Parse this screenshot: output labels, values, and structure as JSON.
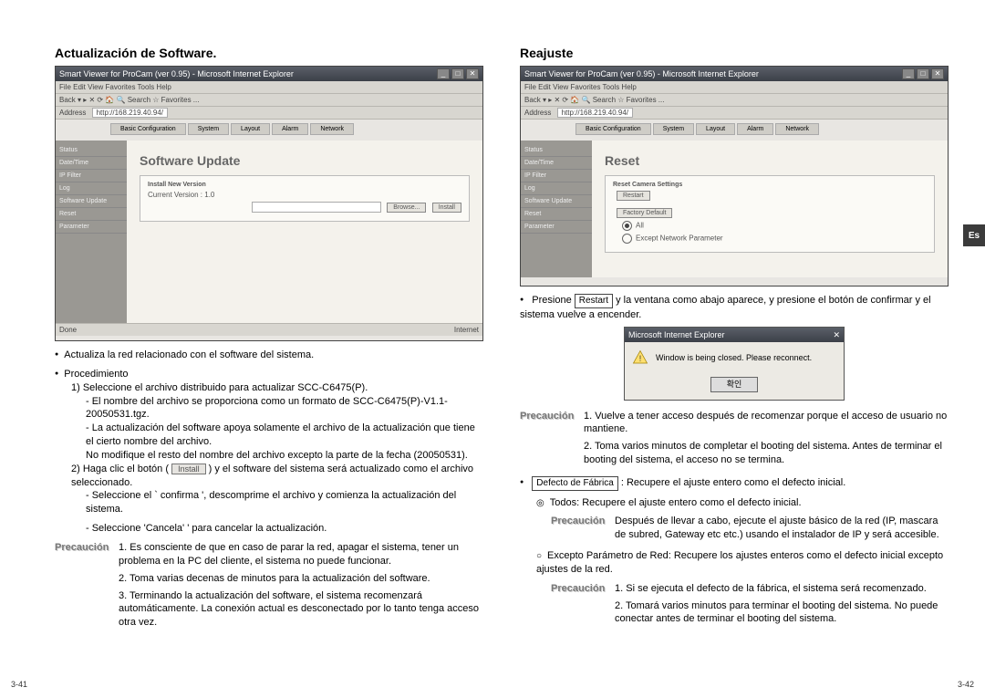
{
  "left": {
    "title": "Actualización de Software.",
    "browser_title": "Smart Viewer for ProCam (ver 0.95) - Microsoft Internet Explorer",
    "menu": "File  Edit  View  Favorites  Tools  Help",
    "toolbar": "Back  ▾   ▸  ✕  ⟳  🏠   🔍 Search  ☆ Favorites  ...",
    "address_label": "Address",
    "address_value": "http://168.219.40.94/",
    "sidebar": [
      "Status",
      "Date/Time",
      "IP Filter",
      "Log",
      "Software Update",
      "Reset",
      "Parameter"
    ],
    "tabs": [
      "Basic Configuration",
      "System",
      "Layout",
      "Alarm",
      "Network"
    ],
    "panel_heading": "Software Update",
    "panel_box_title": "Install New Version",
    "panel_current": "Current Version : 1.0",
    "btn_browse": "Browse...",
    "btn_install": "Install",
    "bullets": [
      "Actualiza la red relacionado con el software del sistema.",
      "Procedimiento"
    ],
    "proc1": "1) Seleccione el archivo distribuido para actualizar SCC-C6475(P).",
    "proc1a": "- El nombre del archivo se proporciona como un formato de SCC-C6475(P)-V1.1-20050531.tgz.",
    "proc1b": "- La actualización del software apoya solamente el archivo de la actualización que tiene el cierto nombre del archivo.",
    "proc1c": "No modifique el resto del nombre del archivo excepto la parte de la fecha (20050531).",
    "proc2a": "2) Haga clic el botón (",
    "proc2_btn": "Install",
    "proc2b": ") y el software del sistema será actualizado como el archivo seleccionado.",
    "proc2c": "- Seleccione el ` confirma ', descomprime el archivo y comienza la actualización del sistema.",
    "proc2d": "- Seleccione 'Cancela' ' para cancelar la actualización.",
    "precaution": "Precaución",
    "prec1": "1. Es consciente de que en caso de parar la red, apagar el sistema, tener un problema en la PC del cliente, el sistema no puede funcionar.",
    "prec2": "2. Toma varias decenas de minutos para la actualización del software.",
    "prec3": "3. Terminando la actualización del software, el sistema recomenzará automáticamente. La conexión actual es desconectado por lo tanto tenga acceso otra vez.",
    "page_num": "3-41"
  },
  "right": {
    "title": "Reajuste",
    "browser_title": "Smart Viewer for ProCam (ver 0.95) - Microsoft Internet Explorer",
    "menu": "File  Edit  View  Favorites  Tools  Help",
    "toolbar": "Back  ▾   ▸  ✕  ⟳  🏠   🔍 Search  ☆ Favorites  ...",
    "address_label": "Address",
    "address_value": "http://168.219.40.94/",
    "sidebar": [
      "Status",
      "Date/Time",
      "IP Filter",
      "Log",
      "Software Update",
      "Reset",
      "Parameter"
    ],
    "tabs": [
      "Basic Configuration",
      "System",
      "Layout",
      "Alarm",
      "Network"
    ],
    "panel_heading": "Reset",
    "panel_box_title": "Reset Camera Settings",
    "btn_restart": "Restart",
    "btn_factory": "Factory Default",
    "radio_all": "All",
    "radio_except": "Except Network Parameter",
    "press_pre": "Presione ",
    "press_btn": "Restart",
    "press_post": " y la ventana como abajo aparece, y presione el botón de confirmar y el sistema vuelve a encender.",
    "dialog_title": "Microsoft Internet Explorer",
    "dialog_msg": "Window is being closed. Please reconnect.",
    "dialog_btn": "확인",
    "precaution": "Precaución",
    "prec_a1": "1. Vuelve a tener acceso después de recomenzar porque el acceso de usuario no mantiene.",
    "prec_a2": "2. Toma varios minutos de completar el booting del sistema. Antes de terminar el booting del sistema, el acceso no se termina.",
    "factory_label": "Defecto de Fábrica",
    "factory_text": ": Recupere el ajuste entero como el defecto inicial.",
    "todos": "Todos: Recupere el ajuste entero como el defecto inicial.",
    "prec_b": "Después de llevar a cabo, ejecute el ajuste básico de la red (IP, mascara de subred, Gateway etc etc.) usando el instalador de IP y será accesible.",
    "excepto": "Excepto Parámetro de Red: Recupere los ajustes enteros como el defecto inicial excepto ajustes de la red.",
    "prec_c1": "1. Si se ejecuta el defecto de la fábrica, el sistema será recomenzado.",
    "prec_c2": "2. Tomará varios minutos para terminar el booting del sistema. No puede conectar antes de terminar el booting del sistema.",
    "page_num": "3-42",
    "lang": "Es"
  }
}
